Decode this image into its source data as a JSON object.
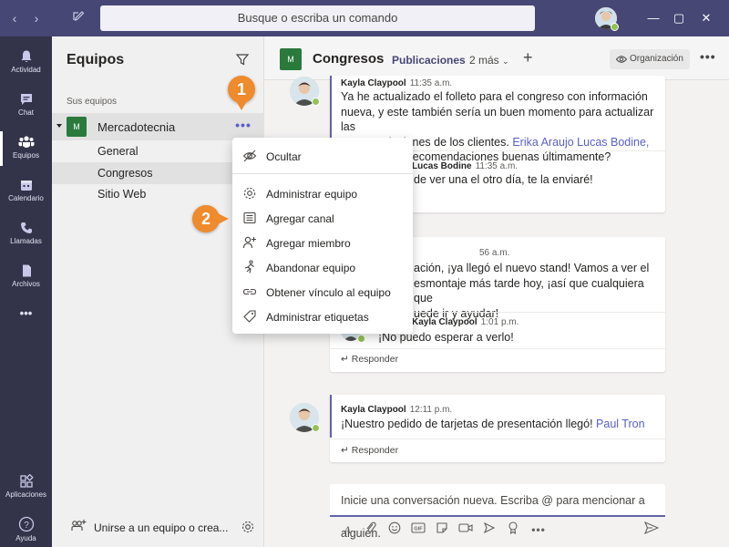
{
  "titlebar": {
    "search_placeholder": "Busque o escriba un comando"
  },
  "appbar": {
    "items": [
      {
        "label": "Actividad",
        "icon": "bell-icon"
      },
      {
        "label": "Chat",
        "icon": "chat-icon"
      },
      {
        "label": "Equipos",
        "icon": "teams-icon"
      },
      {
        "label": "Calendario",
        "icon": "calendar-icon"
      },
      {
        "label": "Llamadas",
        "icon": "phone-icon"
      },
      {
        "label": "Archivos",
        "icon": "file-icon"
      },
      {
        "label": "Aplicaciones",
        "icon": "apps-icon"
      },
      {
        "label": "Ayuda",
        "icon": "help-icon"
      }
    ],
    "more": "•••"
  },
  "panel": {
    "title": "Equipos",
    "section": "Sus equipos",
    "team": {
      "avatar": "M",
      "name": "Mercadotecnia",
      "more": "•••"
    },
    "channels": [
      "General",
      "Congresos",
      "Sitio Web"
    ],
    "join": "Unirse a un equipo o crea..."
  },
  "channel_header": {
    "avatar": "M",
    "name": "Congresos",
    "tab_active": "Publicaciones",
    "tab_more": "2 más",
    "org": "Organización"
  },
  "messages": [
    {
      "author": "Kayla Claypool",
      "time": "11:35 a.m.",
      "text_lines": [
        "Ya he actualizado el folleto para el congreso con información",
        "nueva, y este también sería un buen momento para actualizar las",
        "recomendaciones de los clientes."
      ],
      "mentions": "Erika Araujo Lucas Bodine,",
      "text_tail": "de algunas recomendaciones buenas últimamente?",
      "reply_author": "Lucas Bodine",
      "reply_time": "11:35 a.m.",
      "reply_text": "de ver una el otro día, te la enviaré!"
    },
    {
      "time": "56 a.m.",
      "text_lines": [
        "ación, ¡ya llegó el nuevo stand! Vamos a ver el",
        "esmontaje más tarde hoy, ¡así que cualquiera que",
        "uede ir y ayudar!"
      ],
      "reply_author": "Kayla Claypool",
      "reply_time": "1:01 p.m.",
      "reply_text": "¡No puedo esperar a verlo!",
      "reply_label": "Responder"
    },
    {
      "author": "Kayla Claypool",
      "time": "12:11 p.m.",
      "text": "¡Nuestro pedido de tarjetas de presentación llegó!",
      "mention": "Paul Tron",
      "reply_label": "Responder"
    }
  ],
  "composer": {
    "placeholder": "Inicie una conversación nueva. Escriba @ para mencionar a alguien."
  },
  "menu": {
    "items": [
      {
        "label": "Ocultar",
        "icon": "hide-icon"
      },
      {
        "label": "Administrar equipo",
        "icon": "gear-icon"
      },
      {
        "label": "Agregar canal",
        "icon": "channel-icon"
      },
      {
        "label": "Agregar miembro",
        "icon": "add-member-icon"
      },
      {
        "label": "Abandonar equipo",
        "icon": "leave-icon"
      },
      {
        "label": "Obtener vínculo al equipo",
        "icon": "link-icon"
      },
      {
        "label": "Administrar etiquetas",
        "icon": "tag-icon"
      }
    ]
  },
  "callouts": [
    "1",
    "2"
  ],
  "colors": {
    "titlebar": "#464775",
    "appbar": "#33344a",
    "accent": "#6264a7",
    "callout": "#ef8a2d",
    "team_avatar": "#2a7a3c"
  }
}
